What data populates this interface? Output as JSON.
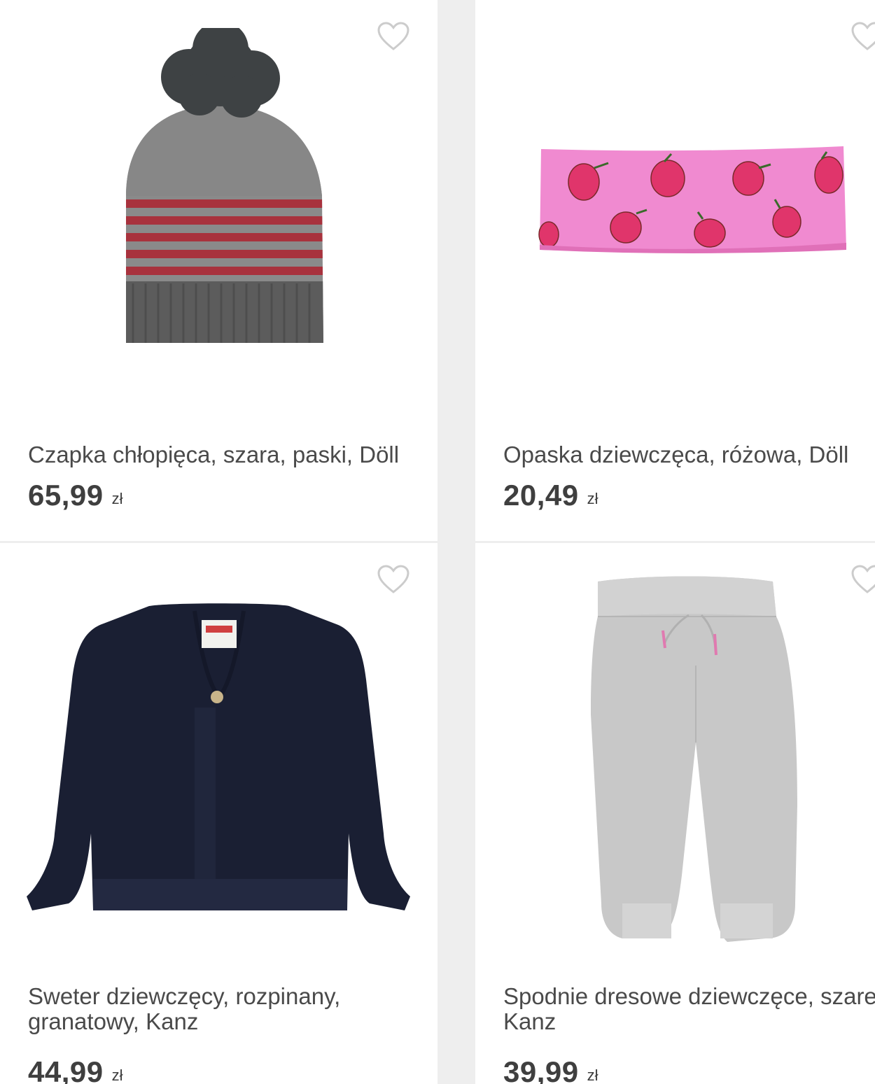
{
  "products": [
    {
      "image": "knitted-hat-image",
      "title": "Czapka chłopięca, szara, paski, Döll",
      "price": "65,99",
      "currency": "zł"
    },
    {
      "image": "strawberry-headband-image",
      "title": "Opaska dziewczęca, różowa, Döll",
      "price": "20,49",
      "currency": "zł"
    },
    {
      "image": "navy-cardigan-image",
      "title": "Sweter dziewczęcy, rozpinany, granatowy, Kanz",
      "price": "44,99",
      "currency": "zł"
    },
    {
      "image": "grey-sweatpants-image",
      "title": "Spodnie dresowe dziewczęce, szare, Kanz",
      "price": "39,99",
      "currency": "zł"
    }
  ],
  "icons": {
    "favorite": "heart-outline-icon"
  },
  "colors": {
    "background": "#eeeeee",
    "card": "#ffffff",
    "text": "#4a4a4a",
    "heart": "#cccccc"
  }
}
